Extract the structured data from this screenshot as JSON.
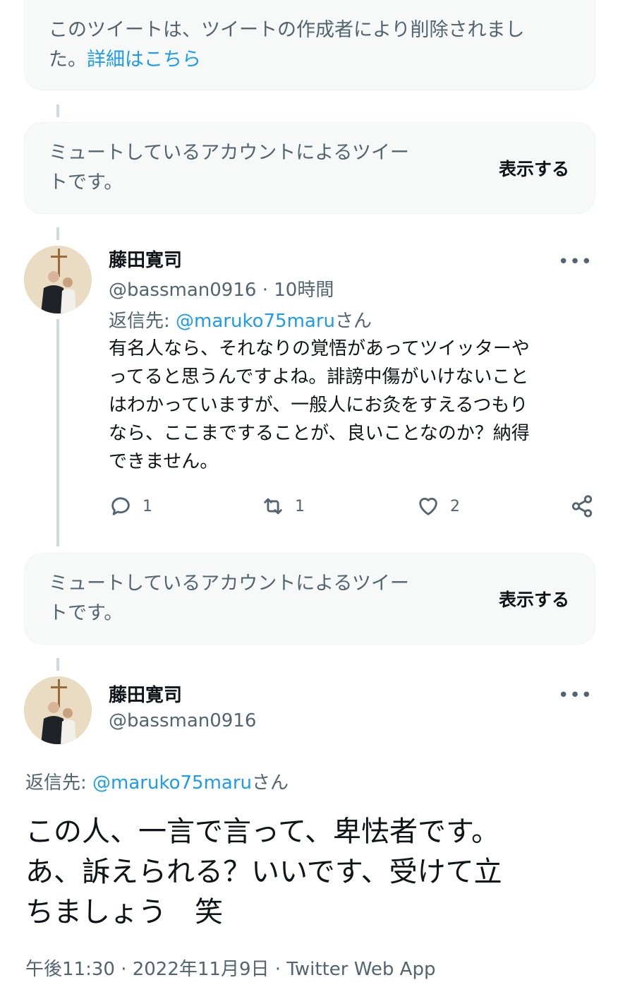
{
  "deleted_notice": {
    "text_line1": "このツイートは、ツイートの作成者により削除されまし",
    "text_line2": "た。",
    "link": "詳細はこちら"
  },
  "muted_notice_1": {
    "line1": "ミュートしているアカウントによるツイー",
    "line2": "トです。",
    "show_label": "表示する"
  },
  "tweet1": {
    "name": "藤田寛司",
    "handle": "@bassman0916",
    "separator": "·",
    "time": "10時間",
    "more": "•••",
    "reply_prefix": "返信先: ",
    "reply_user": "@maruko75maru",
    "reply_suffix": "さん",
    "body_lines": [
      "有名人なら、それなりの覚悟があってツイッターや",
      "ってると思うんですよね。誹謗中傷がいけないこと",
      "はわかっていますが、一般人にお灸をすえるつもり",
      "なら、ここまですることが、良いことなのか？納得",
      "できません。"
    ],
    "reply_count": "1",
    "retweet_count": "1",
    "like_count": "2"
  },
  "muted_notice_2": {
    "line1": "ミュートしているアカウントによるツイー",
    "line2": "トです。",
    "show_label": "表示する"
  },
  "tweet2": {
    "name": "藤田寛司",
    "handle": "@bassman0916",
    "more": "•••",
    "reply_prefix": "返信先: ",
    "reply_user": "@maruko75maru",
    "reply_suffix": "さん",
    "body_lines": [
      "この人、一言で言って、卑怯者です。",
      "あ、訴えられる？いいです、受けて立",
      "ちましょう　笑"
    ],
    "meta": "午後11:30 · 2022年11月9日 · Twitter Web App"
  },
  "colors": {
    "link": "#1d9bf0",
    "secondary_text": "#536471",
    "notice_bg": "#f7f9f9"
  }
}
